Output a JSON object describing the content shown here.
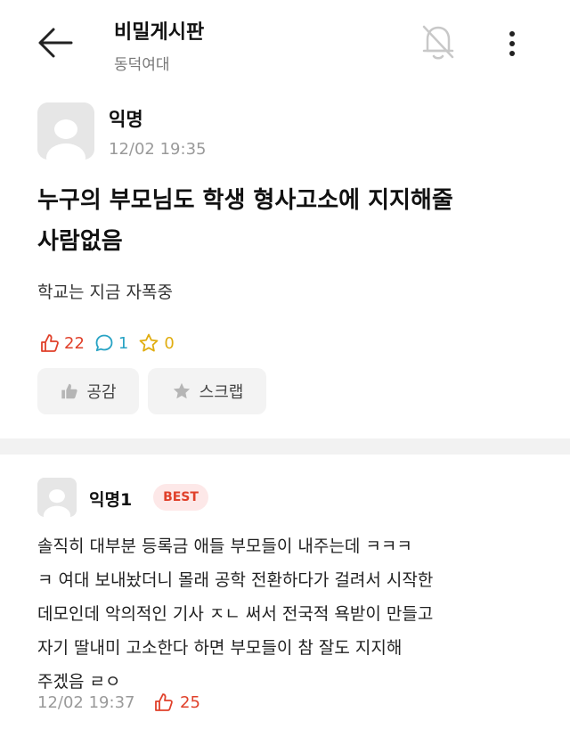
{
  "header": {
    "board_title": "비밀게시판",
    "school": "동덕여대",
    "icons": {
      "back": "back-arrow-icon",
      "notify": "bell-off-icon",
      "more": "more-vertical-icon"
    }
  },
  "post": {
    "author": "익명",
    "time": "12/02 19:35",
    "title_lines": [
      "누구의 부모님도 학생 형사고소에 지지해줄",
      "사람없음"
    ],
    "body": "학교는 지금 자폭중",
    "stats": {
      "likes": "22",
      "comments": "1",
      "scraps": "0"
    },
    "buttons": {
      "like": "공감",
      "scrap": "스크랩"
    }
  },
  "comment": {
    "author": "익명1",
    "badge": "BEST",
    "lines": [
      "솔직히 대부분 등록금 애들 부모들이 내주는데 ㅋㅋㅋ",
      "ㅋ 여대 보내놨더니 몰래 공학 전환하다가 걸려서 시작한",
      "데모인데 악의적인 기사 ㅈㄴ 써서 전국적 욕받이 만들고",
      "자기 딸내미 고소한다 하면 부모들이 참 잘도 지지해",
      "주겠음 ㄹㅇ"
    ],
    "time": "12/02 19:37",
    "likes": "25"
  },
  "colors": {
    "like": "#e0402a",
    "comment": "#28a3c4",
    "scrap": "#e0ad10",
    "divider": "#f2f2f2"
  }
}
